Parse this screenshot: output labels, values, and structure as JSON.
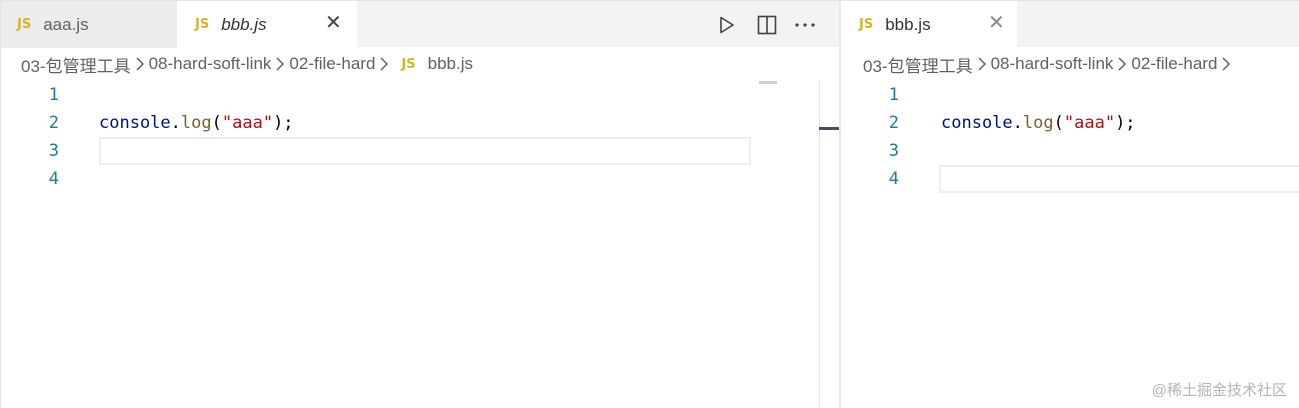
{
  "left_pane": {
    "tabs": [
      {
        "icon": "JS",
        "label": "aaa.js",
        "state": "inactive"
      },
      {
        "icon": "JS",
        "label": "bbb.js",
        "state": "active",
        "close": "✕"
      }
    ],
    "actions": [
      "run-icon",
      "split-editor-icon",
      "more-actions-icon"
    ],
    "breadcrumb": {
      "folders": [
        "03-包管理工具",
        "08-hard-soft-link",
        "02-file-hard"
      ],
      "file_icon": "JS",
      "file": "bbb.js"
    },
    "lines": [
      {
        "number": "1",
        "tokens": []
      },
      {
        "number": "2",
        "tokens": [
          {
            "text": "console",
            "kind": "var"
          },
          {
            "text": ".",
            "kind": "punc"
          },
          {
            "text": "log",
            "kind": "fn"
          },
          {
            "text": "(",
            "kind": "punc"
          },
          {
            "text": "\"aaa\"",
            "kind": "str"
          },
          {
            "text": ");",
            "kind": "punc"
          }
        ]
      },
      {
        "number": "3",
        "tokens": []
      },
      {
        "number": "4",
        "tokens": []
      }
    ],
    "current_line": 3
  },
  "right_pane": {
    "tabs": [
      {
        "icon": "JS",
        "label": "bbb.js",
        "state": "active",
        "close": "✕"
      }
    ],
    "breadcrumb": {
      "folders": [
        "03-包管理工具",
        "08-hard-soft-link",
        "02-file-hard"
      ]
    },
    "lines": [
      {
        "number": "1",
        "tokens": []
      },
      {
        "number": "2",
        "tokens": [
          {
            "text": "console",
            "kind": "var"
          },
          {
            "text": ".",
            "kind": "punc"
          },
          {
            "text": "log",
            "kind": "fn"
          },
          {
            "text": "(",
            "kind": "punc"
          },
          {
            "text": "\"aaa\"",
            "kind": "str"
          },
          {
            "text": ");",
            "kind": "punc"
          }
        ]
      },
      {
        "number": "3",
        "tokens": []
      },
      {
        "number": "4",
        "tokens": []
      }
    ],
    "current_line": 4
  },
  "watermark": "@稀土掘金技术社区",
  "colors": {
    "js_icon": "#d8b326",
    "line_number": "#237893",
    "variable": "#001080",
    "function": "#795e26",
    "string": "#a31515"
  }
}
